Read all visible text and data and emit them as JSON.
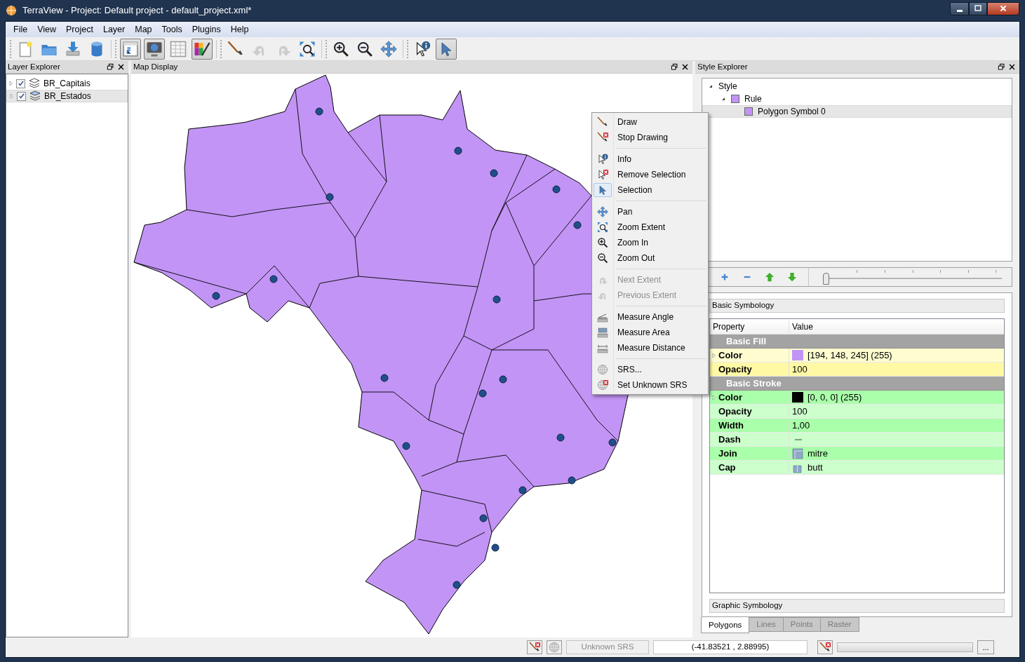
{
  "window": {
    "title": "TerraView - Project: Default project - default_project.xml*"
  },
  "menu": [
    "File",
    "View",
    "Project",
    "Layer",
    "Map",
    "Tools",
    "Plugins",
    "Help"
  ],
  "toolbar": [
    [
      {
        "kind": "new-file",
        "pressed": false,
        "disabled": false
      },
      {
        "kind": "open-folder",
        "pressed": false,
        "disabled": false
      },
      {
        "kind": "save",
        "pressed": false,
        "disabled": false
      },
      {
        "kind": "database",
        "pressed": false,
        "disabled": false
      }
    ],
    [
      {
        "kind": "layer-panel",
        "pressed": true,
        "disabled": false
      },
      {
        "kind": "map-panel",
        "pressed": true,
        "disabled": false
      },
      {
        "kind": "table",
        "pressed": false,
        "disabled": false
      },
      {
        "kind": "style",
        "pressed": true,
        "disabled": false
      }
    ],
    [
      {
        "kind": "draw",
        "pressed": false,
        "disabled": false
      },
      {
        "kind": "undo",
        "pressed": false,
        "disabled": true
      },
      {
        "kind": "redo",
        "pressed": false,
        "disabled": true
      },
      {
        "kind": "zoom-extent",
        "pressed": false,
        "disabled": false
      }
    ],
    [
      {
        "kind": "zoom-in",
        "pressed": false,
        "disabled": false
      },
      {
        "kind": "zoom-out",
        "pressed": false,
        "disabled": false
      },
      {
        "kind": "pan",
        "pressed": false,
        "disabled": false
      }
    ],
    [
      {
        "kind": "info",
        "pressed": false,
        "disabled": false
      },
      {
        "kind": "pointer",
        "pressed": true,
        "disabled": false
      }
    ]
  ],
  "layer_explorer": {
    "title": "Layer Explorer",
    "layers": [
      {
        "name": "BR_Capitais",
        "checked": true,
        "selected": false,
        "expanded": false
      },
      {
        "name": "BR_Estados",
        "checked": true,
        "selected": true,
        "expanded": false
      }
    ]
  },
  "map_display": {
    "title": "Map Display"
  },
  "context_menu": {
    "groups": [
      [
        {
          "label": "Draw",
          "kind": "draw",
          "disabled": false,
          "checked": false
        },
        {
          "label": "Stop Drawing",
          "kind": "stop-draw",
          "disabled": false,
          "checked": false
        }
      ],
      [
        {
          "label": "Info",
          "kind": "info",
          "disabled": false,
          "checked": false
        },
        {
          "label": "Remove Selection",
          "kind": "remove-selection",
          "disabled": false,
          "checked": false
        },
        {
          "label": "Selection",
          "kind": "pointer",
          "disabled": false,
          "checked": true
        }
      ],
      [
        {
          "label": "Pan",
          "kind": "pan",
          "disabled": false,
          "checked": false
        },
        {
          "label": "Zoom Extent",
          "kind": "zoom-extent",
          "disabled": false,
          "checked": false
        },
        {
          "label": "Zoom In",
          "kind": "zoom-in",
          "disabled": false,
          "checked": false
        },
        {
          "label": "Zoom Out",
          "kind": "zoom-out",
          "disabled": false,
          "checked": false
        }
      ],
      [
        {
          "label": "Next Extent",
          "kind": "redo",
          "disabled": true,
          "checked": false
        },
        {
          "label": "Previous Extent",
          "kind": "undo",
          "disabled": true,
          "checked": false
        }
      ],
      [
        {
          "label": "Measure Angle",
          "kind": "measure-angle",
          "disabled": false,
          "checked": false
        },
        {
          "label": "Measure Area",
          "kind": "measure-area",
          "disabled": false,
          "checked": false
        },
        {
          "label": "Measure Distance",
          "kind": "measure-distance",
          "disabled": false,
          "checked": false
        }
      ],
      [
        {
          "label": "SRS...",
          "kind": "srs",
          "disabled": false,
          "checked": false
        },
        {
          "label": "Set Unknown SRS",
          "kind": "unknown-srs",
          "disabled": false,
          "checked": false
        }
      ]
    ]
  },
  "style_explorer": {
    "title": "Style Explorer",
    "tree": [
      {
        "label": "Style",
        "expanded": true,
        "selected": false,
        "children": [
          {
            "label": "Rule",
            "color": "#c294f5",
            "expanded": true,
            "selected": false,
            "children": [
              {
                "label": "Polygon Symbol 0",
                "color": "#c294f5",
                "selected": true
              }
            ]
          }
        ]
      }
    ],
    "slider": {
      "level": 0
    },
    "basic_symbology": {
      "title": "Basic Symbology",
      "columns": [
        "Property",
        "Value"
      ],
      "sections": [
        {
          "title": "Basic Fill",
          "kind": "fill",
          "rows": [
            {
              "property": "Color",
              "kind": "color",
              "color": "#c294f5",
              "value": "[194, 148, 245] (255)",
              "expandable": true
            },
            {
              "property": "Opacity",
              "kind": "text",
              "value": "100",
              "expandable": false
            }
          ]
        },
        {
          "title": "Basic Stroke",
          "kind": "stroke",
          "rows": [
            {
              "property": "Color",
              "kind": "color",
              "color": "#000000",
              "value": "[0, 0, 0] (255)",
              "expandable": true
            },
            {
              "property": "Opacity",
              "kind": "text",
              "value": "100",
              "expandable": false
            },
            {
              "property": "Width",
              "kind": "text",
              "value": "1,00",
              "expandable": false
            },
            {
              "property": "Dash",
              "kind": "dash",
              "expandable": false
            },
            {
              "property": "Join",
              "kind": "join",
              "value": "mitre",
              "expandable": false
            },
            {
              "property": "Cap",
              "kind": "cap",
              "value": "butt",
              "expandable": false
            }
          ]
        }
      ]
    },
    "graphic_symbology": {
      "title": "Graphic Symbology"
    },
    "tabs": [
      {
        "label": "Polygons",
        "selected": true
      },
      {
        "label": "Lines",
        "selected": false
      },
      {
        "label": "Points",
        "selected": false
      },
      {
        "label": "Raster",
        "selected": false
      }
    ]
  },
  "status_bar": {
    "srs": "Unknown SRS",
    "coordinates": "(-41.83521 , 2.88995)",
    "progress_button": "...",
    "progress": {
      "level": 0
    }
  }
}
